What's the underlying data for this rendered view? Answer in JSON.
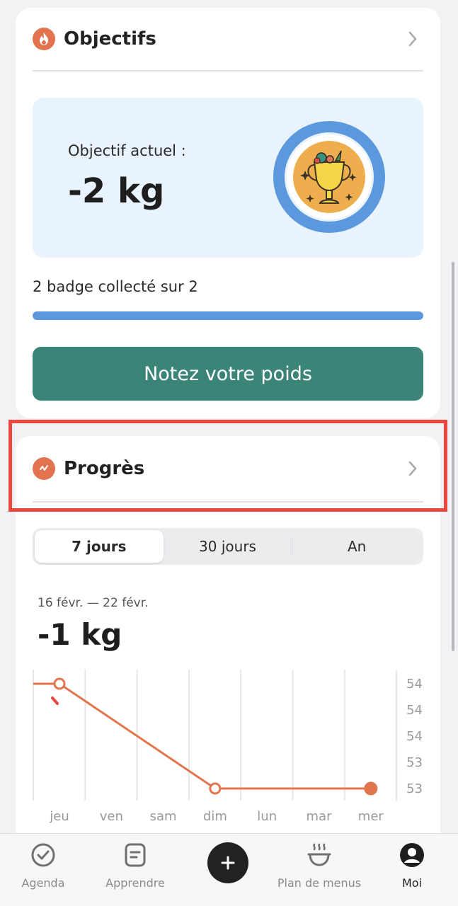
{
  "objectives": {
    "title": "Objectifs",
    "current_goal_label": "Objectif actuel :",
    "current_goal_value": "-2 kg",
    "badge_text": "2 badge collecté sur 2",
    "badges_collected": 2,
    "badges_total": 2,
    "progress_fraction": 1.0,
    "cta_label": "Notez votre poids",
    "icon": "flame-icon"
  },
  "progress": {
    "title": "Progrès",
    "icon": "progress-icon",
    "tabs": [
      {
        "label": "7 jours",
        "active": true
      },
      {
        "label": "30 jours",
        "active": false
      },
      {
        "label": "An",
        "active": false
      }
    ],
    "date_range": "16 févr. — 22 févr.",
    "delta": "-1 kg"
  },
  "chart_data": {
    "type": "line",
    "categories": [
      "jeu",
      "ven",
      "sam",
      "dim",
      "lun",
      "mar",
      "mer"
    ],
    "y_tick_labels": [
      "54",
      "54",
      "54",
      "53",
      "53"
    ],
    "ylim": [
      53.0,
      54.0
    ],
    "series": [
      {
        "values": [
          54.0,
          null,
          null,
          53.0,
          null,
          null,
          53.0
        ],
        "color": "#e0754e"
      }
    ],
    "grid": true
  },
  "nav": {
    "items": [
      {
        "label": "Agenda",
        "icon": "check-circle-icon",
        "active": false
      },
      {
        "label": "Apprendre",
        "icon": "book-icon",
        "active": false
      },
      {
        "label": "Plan de menus",
        "icon": "dish-icon",
        "active": false
      },
      {
        "label": "Moi",
        "icon": "user-icon",
        "active": true
      }
    ],
    "add_icon": "plus-icon"
  },
  "colors": {
    "accent_orange": "#e2734f",
    "accent_blue": "#5b98de",
    "cta_green": "#3b8478",
    "highlight_red": "#e8483d"
  }
}
